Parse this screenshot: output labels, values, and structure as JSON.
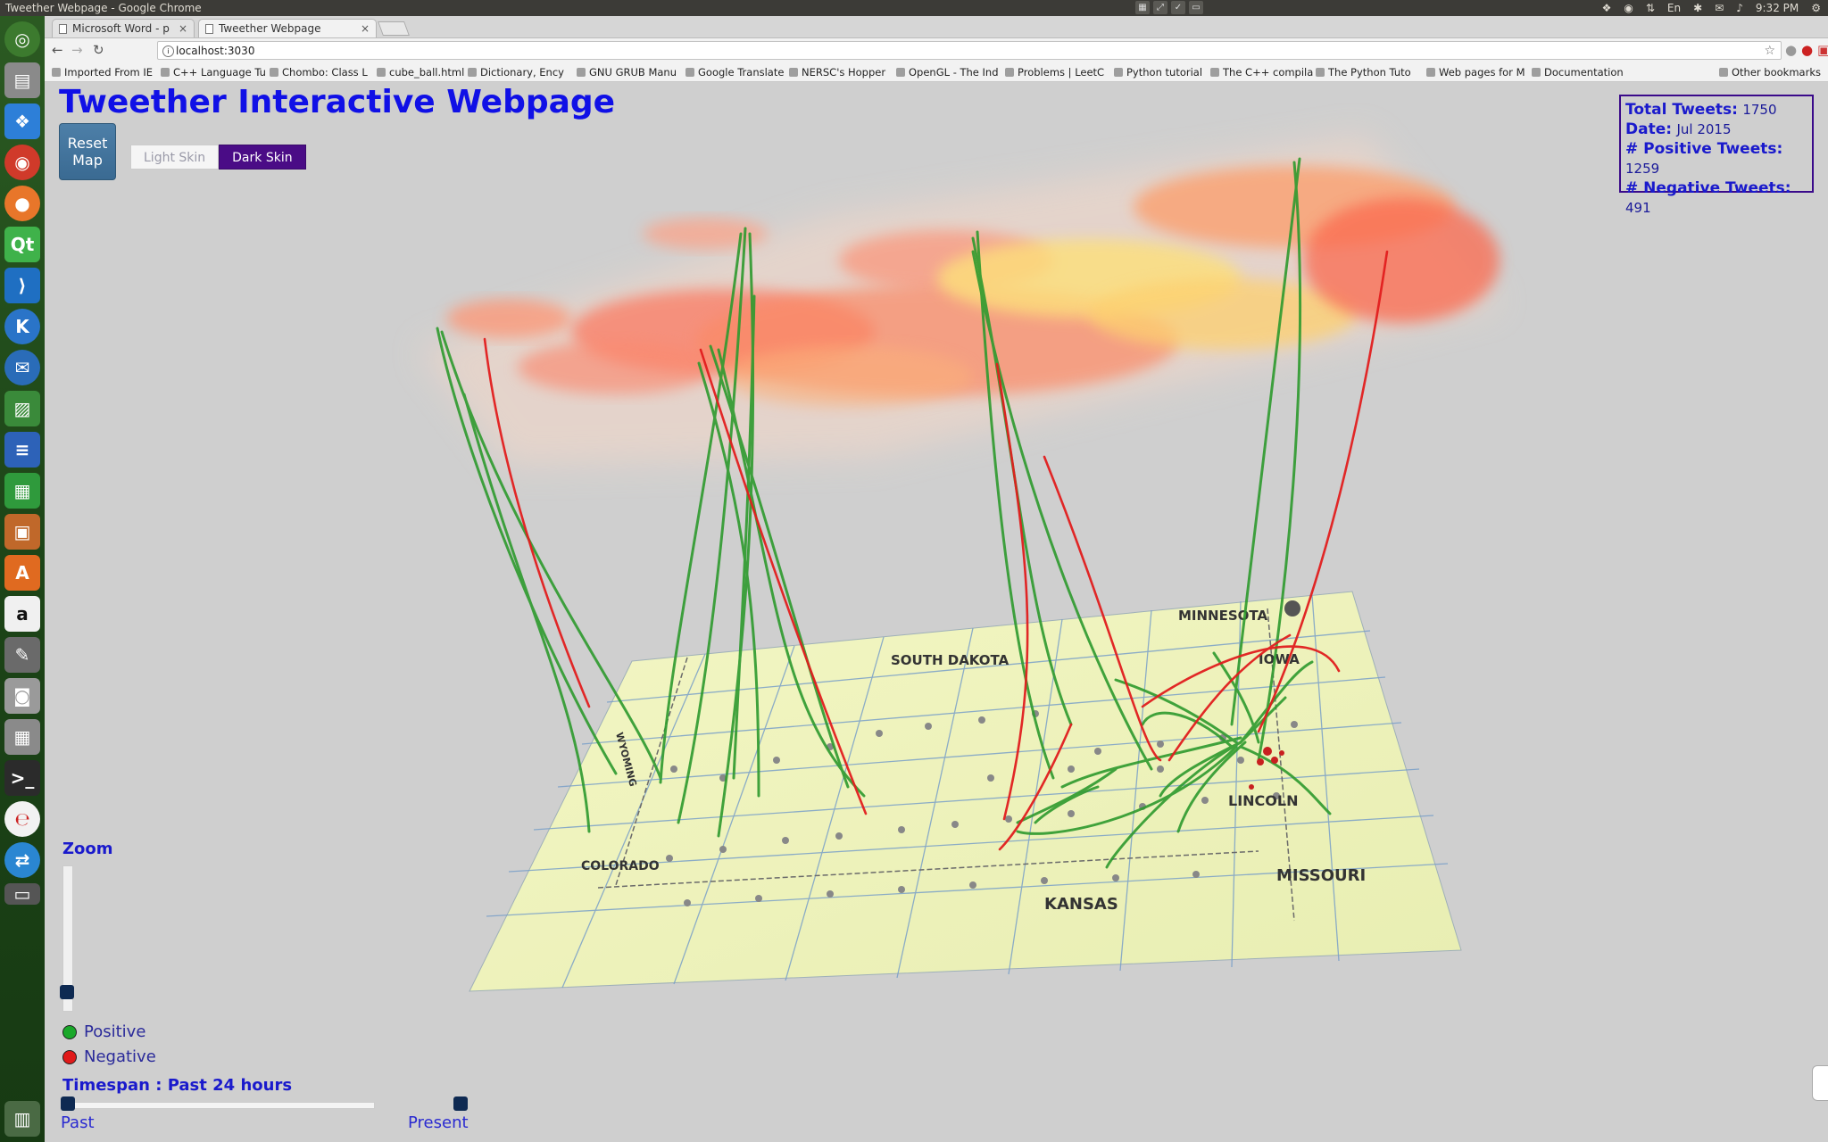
{
  "os": {
    "window_title": "Tweether Webpage - Google Chrome",
    "clock": "9:32 PM",
    "tray_lang": "En"
  },
  "browser": {
    "tabs": [
      {
        "label": "Microsoft Word - p",
        "active": false
      },
      {
        "label": "Tweether Webpage",
        "active": true
      }
    ],
    "url": "localhost:3030",
    "bookmarks": [
      "Imported From IE",
      "C++ Language Tu",
      "Chombo: Class L",
      "cube_ball.html",
      "Dictionary, Ency",
      "GNU GRUB Manu",
      "Google Translate",
      "NERSC's Hopper",
      "OpenGL - The Ind",
      "Problems | LeetC",
      "Python tutorial",
      "The C++ compila",
      "The Python Tuto",
      "Web pages for M",
      "Documentation"
    ],
    "other_bookmarks": "Other bookmarks"
  },
  "page": {
    "title": "Tweether Interactive Webpage",
    "reset_button": "Reset Map",
    "skin_light": "Light Skin",
    "skin_dark": "Dark Skin",
    "zoom_label": "Zoom",
    "zoom_level": 0.15,
    "legend_positive": "Positive",
    "legend_negative": "Negative",
    "timespan_label": "Timespan : Past 24 hours",
    "time_past": "Past",
    "time_present": "Present",
    "stats": {
      "total_label": "Total Tweets:",
      "total": "1750",
      "date_label": "Date:",
      "date": "Jul 2015",
      "positive_label": "# Positive Tweets:",
      "positive": "1259",
      "negative_label": "# Negative Tweets:",
      "negative": "491"
    },
    "map_labels": [
      "SOUTH DAKOTA",
      "MINNESOTA",
      "IOWA",
      "LINCOLN",
      "COLORADO",
      "KANSAS",
      "MISSOURI",
      "WYOMING"
    ],
    "colors": {
      "positive": "#1aa82a",
      "negative": "#e01a1a",
      "title": "#1010e6",
      "dark_skin": "#4a0c86"
    }
  }
}
